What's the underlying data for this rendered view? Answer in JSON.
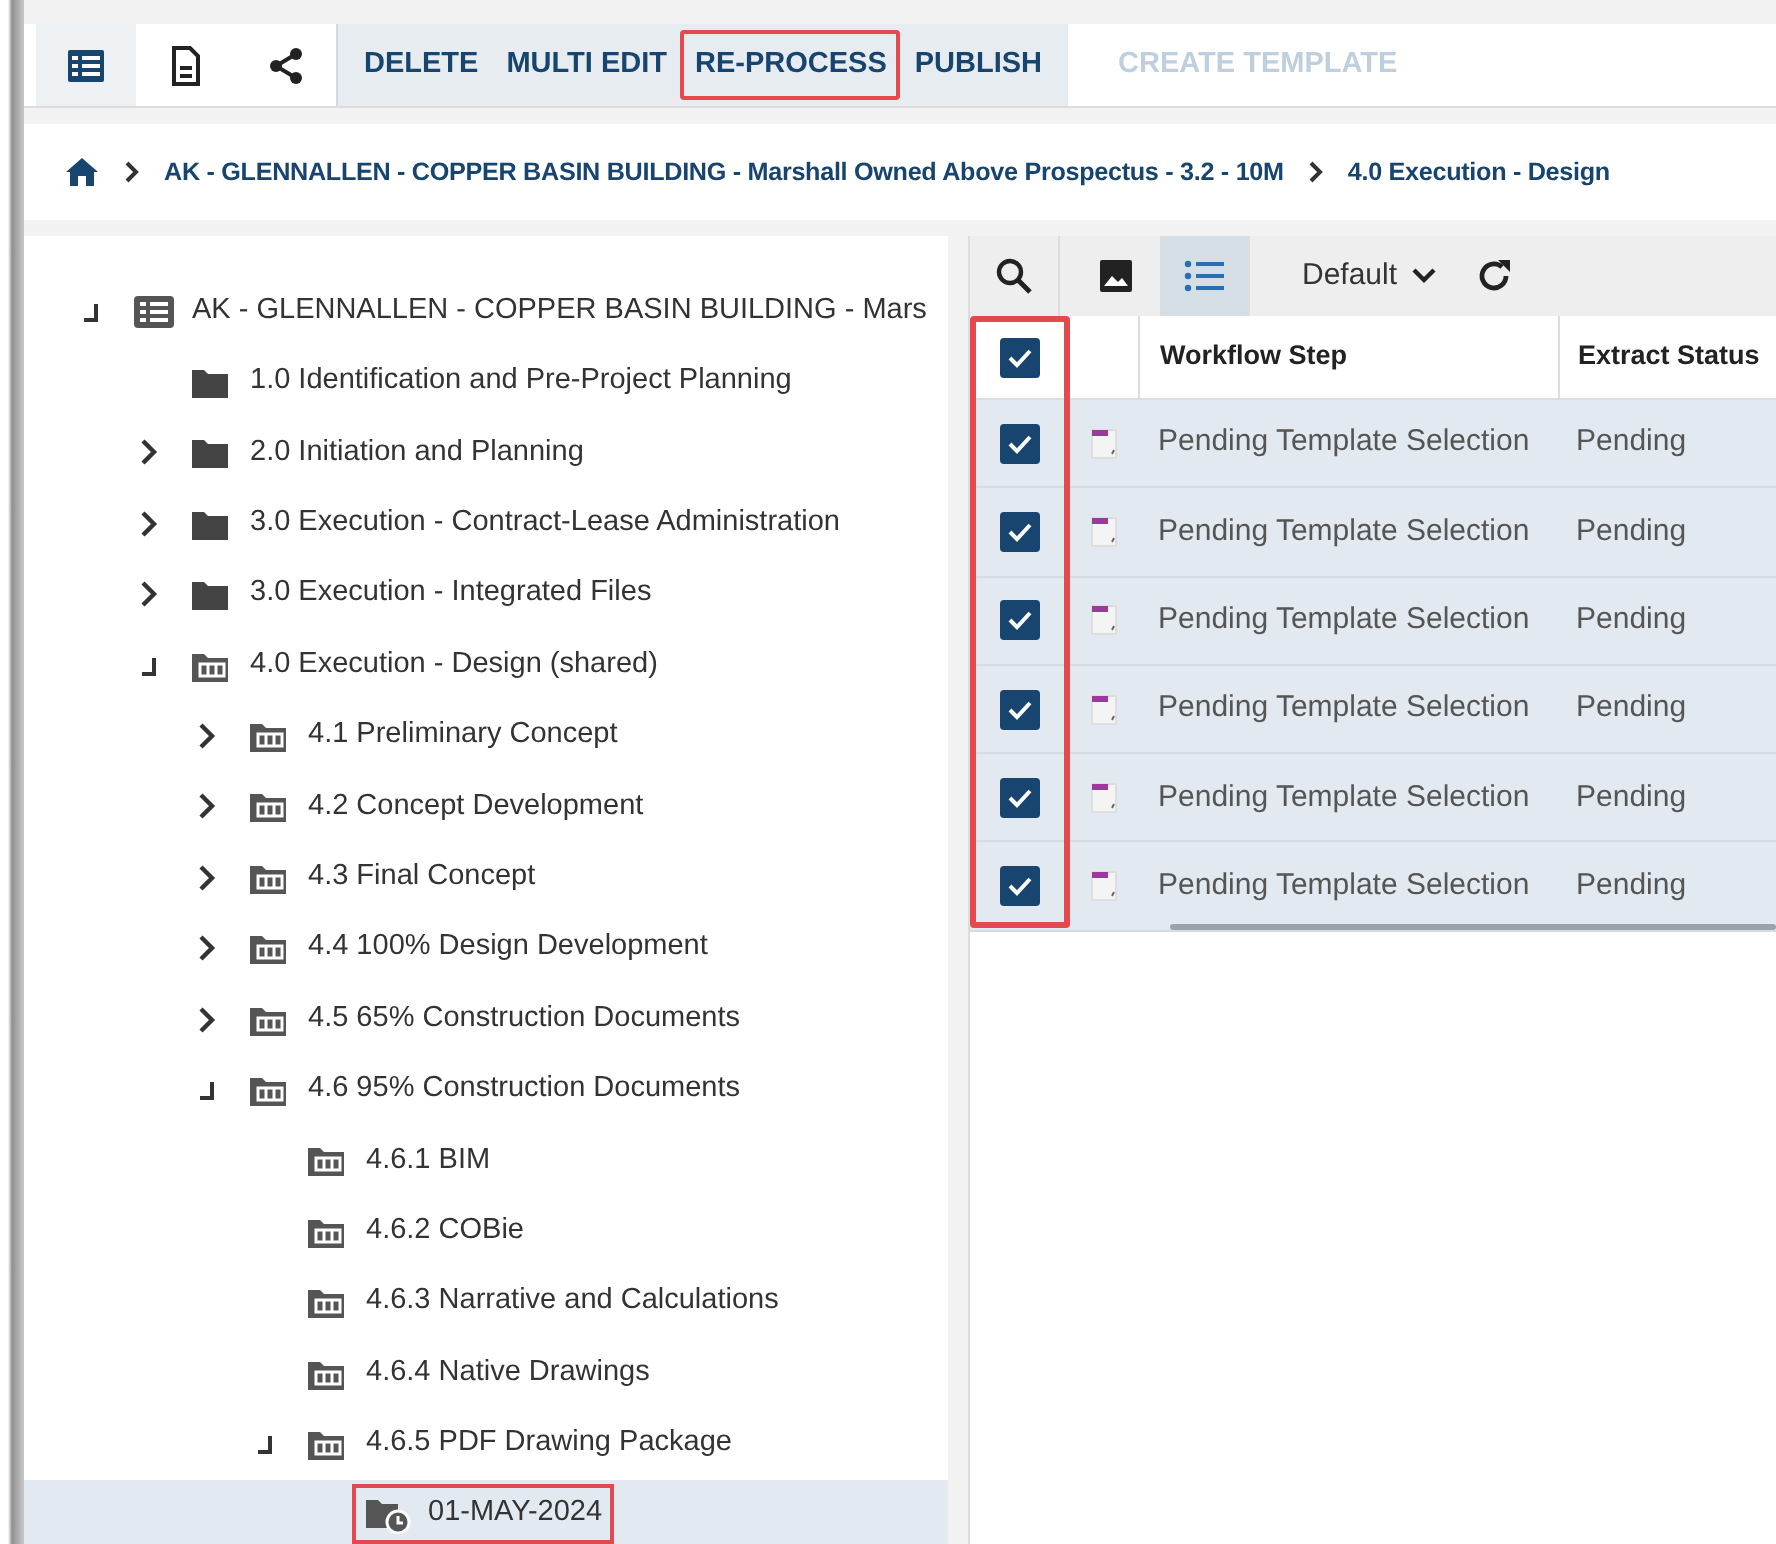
{
  "toolbar": {
    "views": [
      {
        "kind": "table",
        "selected": true
      },
      {
        "kind": "document",
        "selected": false
      },
      {
        "kind": "share",
        "selected": false
      }
    ],
    "actions": [
      {
        "label": "DELETE",
        "disabled": false,
        "highlighted": false
      },
      {
        "label": "MULTI EDIT",
        "disabled": false,
        "highlighted": false
      },
      {
        "label": "RE-PROCESS",
        "disabled": false,
        "highlighted": true
      },
      {
        "label": "PUBLISH",
        "disabled": false,
        "highlighted": false
      },
      {
        "label": "CREATE TEMPLATE",
        "disabled": true,
        "highlighted": false
      }
    ]
  },
  "breadcrumb": [
    "AK - GLENNALLEN - COPPER BASIN BUILDING - Marshall Owned Above Prospectus - 3.2 - 10M",
    "4.0 Execution - Design"
  ],
  "tree": [
    {
      "label": "AK - GLENNALLEN - COPPER BASIN BUILDING - Mars",
      "kind": "project",
      "expanded": true,
      "selected": false,
      "highlighted": false,
      "children": [
        {
          "label": "1.0 Identification and Pre-Project Planning",
          "kind": "folder",
          "selected": false,
          "highlighted": false
        },
        {
          "label": "2.0 Initiation and Planning",
          "kind": "folder",
          "expanded": false,
          "selected": false,
          "highlighted": false
        },
        {
          "label": "3.0 Execution - Contract-Lease Administration",
          "kind": "folder",
          "expanded": false,
          "selected": false,
          "highlighted": false
        },
        {
          "label": "3.0 Execution - Integrated Files",
          "kind": "folder",
          "expanded": false,
          "selected": false,
          "highlighted": false
        },
        {
          "label": "4.0 Execution - Design (shared)",
          "kind": "shared",
          "expanded": true,
          "selected": false,
          "highlighted": false,
          "children": [
            {
              "label": "4.1 Preliminary Concept",
              "kind": "shared",
              "expanded": false,
              "selected": false,
              "highlighted": false
            },
            {
              "label": "4.2 Concept Development",
              "kind": "shared",
              "expanded": false,
              "selected": false,
              "highlighted": false
            },
            {
              "label": "4.3 Final Concept",
              "kind": "shared",
              "expanded": false,
              "selected": false,
              "highlighted": false
            },
            {
              "label": "4.4 100% Design Development",
              "kind": "shared",
              "expanded": false,
              "selected": false,
              "highlighted": false
            },
            {
              "label": "4.5 65% Construction Documents",
              "kind": "shared",
              "expanded": false,
              "selected": false,
              "highlighted": false
            },
            {
              "label": "4.6 95% Construction Documents",
              "kind": "shared",
              "expanded": true,
              "selected": false,
              "highlighted": false,
              "children": [
                {
                  "label": "4.6.1 BIM",
                  "kind": "shared",
                  "selected": false,
                  "highlighted": false
                },
                {
                  "label": "4.6.2 COBie",
                  "kind": "shared",
                  "selected": false,
                  "highlighted": false
                },
                {
                  "label": "4.6.3 Narrative and Calculations",
                  "kind": "shared",
                  "selected": false,
                  "highlighted": false
                },
                {
                  "label": "4.6.4 Native Drawings",
                  "kind": "shared",
                  "selected": false,
                  "highlighted": false
                },
                {
                  "label": "4.6.5 PDF Drawing Package",
                  "kind": "shared",
                  "expanded": true,
                  "selected": false,
                  "highlighted": false,
                  "children": [
                    {
                      "label": "01-MAY-2024",
                      "kind": "dated",
                      "selected": true,
                      "highlighted": true
                    }
                  ]
                }
              ]
            }
          ]
        }
      ]
    }
  ],
  "grid_toolbar": {
    "views": [
      {
        "kind": "image",
        "selected": false
      },
      {
        "kind": "list",
        "selected": true
      }
    ],
    "layout": "Default"
  },
  "table": {
    "select_all_checked": true,
    "checkbox_column_highlighted": true,
    "columns": [
      "Workflow Step",
      "Extract Status"
    ],
    "rows": [
      {
        "checked": true,
        "selected": true,
        "cells": [
          "Pending Template Selection",
          "Pending"
        ]
      },
      {
        "checked": true,
        "selected": true,
        "cells": [
          "Pending Template Selection",
          "Pending"
        ]
      },
      {
        "checked": true,
        "selected": true,
        "cells": [
          "Pending Template Selection",
          "Pending"
        ]
      },
      {
        "checked": true,
        "selected": true,
        "cells": [
          "Pending Template Selection",
          "Pending"
        ]
      },
      {
        "checked": true,
        "selected": true,
        "cells": [
          "Pending Template Selection",
          "Pending"
        ]
      },
      {
        "checked": true,
        "selected": true,
        "cells": [
          "Pending Template Selection",
          "Pending"
        ]
      }
    ]
  }
}
